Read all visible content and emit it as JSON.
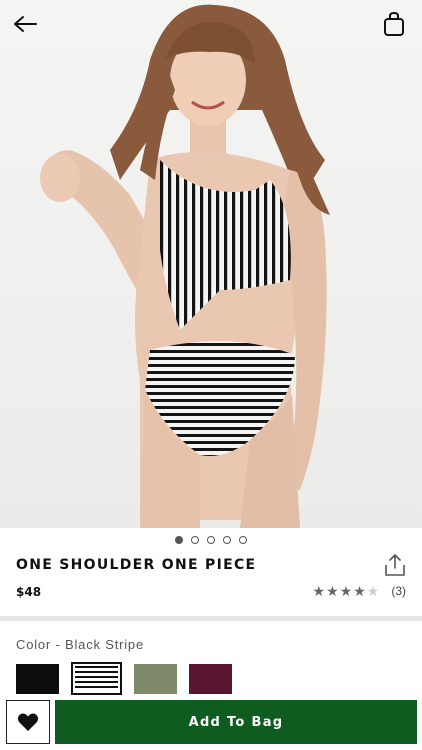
{
  "header": {
    "back_icon": "arrow-left-icon",
    "bag_icon": "shopping-bag-icon"
  },
  "gallery": {
    "image_count": 5,
    "active_index": 0
  },
  "product": {
    "title": "ONE SHOULDER ONE PIECE",
    "price": "$48",
    "rating_value": 4.5,
    "rating_count": "(3)",
    "share_icon": "share-icon"
  },
  "color": {
    "label": "Color - Black Stripe",
    "swatches": [
      {
        "name": "black",
        "color": "#0d0d0d",
        "selected": false
      },
      {
        "name": "black-stripe",
        "color": "#111111",
        "selected": true
      },
      {
        "name": "olive",
        "color": "#7e8a6a",
        "selected": false
      },
      {
        "name": "plum",
        "color": "#5a1630",
        "selected": false
      }
    ]
  },
  "actions": {
    "wishlist_icon": "heart-icon",
    "add_to_bag_label": "Add To Bag",
    "brand_green": "#0e5c20"
  }
}
